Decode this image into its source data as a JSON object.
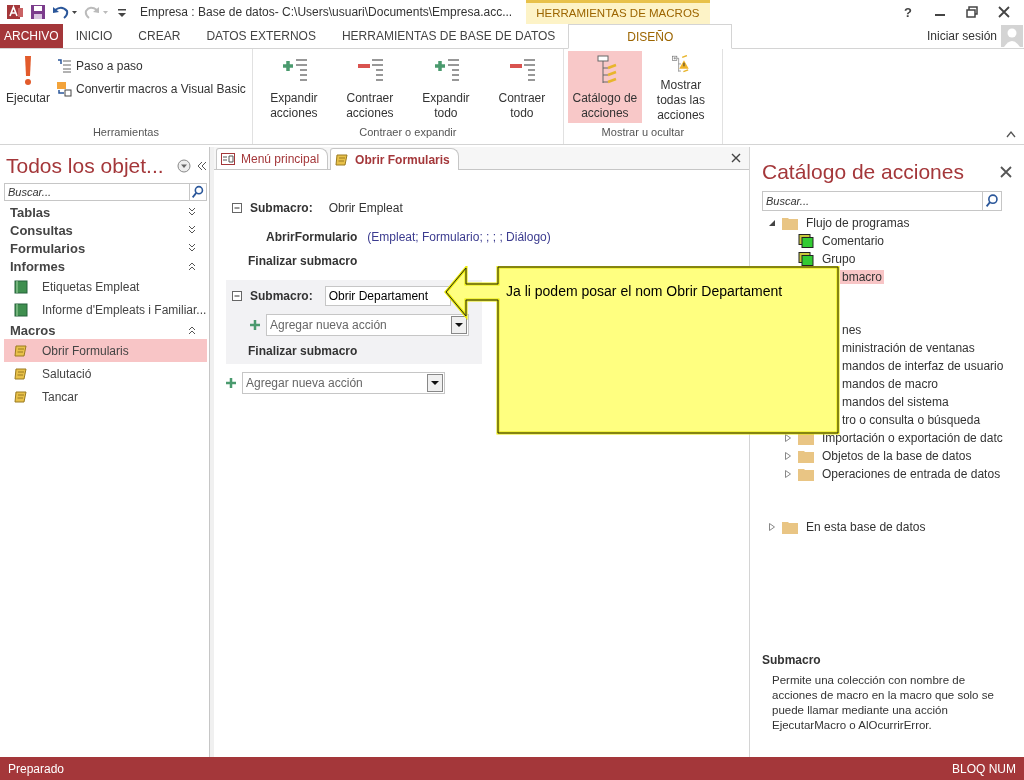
{
  "title_bar": {
    "title": "Empresa : Base de datos- C:\\Users\\usuari\\Documents\\Empresa.acc...",
    "context_tab": "HERRAMIENTAS DE MACROS",
    "help": "?"
  },
  "ribbon_tabs": [
    {
      "label": "ARCHIVO",
      "kind": "file",
      "selected": false
    },
    {
      "label": "INICIO",
      "kind": "normal",
      "selected": false
    },
    {
      "label": "CREAR",
      "kind": "normal",
      "selected": false
    },
    {
      "label": "DATOS EXTERNOS",
      "kind": "normal",
      "selected": false
    },
    {
      "label": "HERRAMIENTAS DE BASE DE DATOS",
      "kind": "normal",
      "selected": false
    },
    {
      "label": "DISEÑO",
      "kind": "context",
      "selected": true
    }
  ],
  "account": "Iniciar sesión",
  "ribbon_groups": [
    {
      "label": "Herramientas",
      "buttons": [
        {
          "label": "Ejecutar",
          "kind": "run",
          "selected": false
        },
        {
          "label": "Paso a paso",
          "kind": "step",
          "selected": false
        },
        {
          "label": "Convertir macros a Visual Basic",
          "kind": "convert",
          "selected": false
        }
      ]
    },
    {
      "label": "Contraer o expandir",
      "buttons": [
        {
          "label": "Expandir acciones",
          "kind": "expand",
          "selected": false
        },
        {
          "label": "Contraer acciones",
          "kind": "collapse",
          "selected": false
        },
        {
          "label": "Expandir todo",
          "kind": "expand",
          "selected": false
        },
        {
          "label": "Contraer todo",
          "kind": "collapse",
          "selected": false
        }
      ]
    },
    {
      "label": "Mostrar u ocultar",
      "buttons": [
        {
          "label": "Catálogo de acciones",
          "kind": "catalog",
          "selected": true
        },
        {
          "label": "Mostrar todas las acciones",
          "kind": "showall",
          "selected": false
        }
      ]
    }
  ],
  "nav": {
    "title": "Todos los objet...",
    "search_placeholder": "Buscar...",
    "groups": [
      {
        "label": "Tablas",
        "expanded": false
      },
      {
        "label": "Consultas",
        "expanded": false
      },
      {
        "label": "Formularios",
        "expanded": false
      },
      {
        "label": "Informes",
        "expanded": true,
        "items": [
          {
            "label": "Etiquetas Empleat",
            "kind": "report",
            "selected": false
          },
          {
            "label": "Informe d'Empleats i Familiar...",
            "kind": "report",
            "selected": false
          }
        ]
      },
      {
        "label": "Macros",
        "expanded": true,
        "items": [
          {
            "label": "Obrir Formularis",
            "kind": "macro",
            "selected": true
          },
          {
            "label": "Salutació",
            "kind": "macro",
            "selected": false
          },
          {
            "label": "Tancar",
            "kind": "macro",
            "selected": false
          }
        ]
      }
    ]
  },
  "doc_tabs": [
    {
      "label": "Menú principal",
      "kind": "form",
      "selected": false
    },
    {
      "label": "Obrir Formularis",
      "kind": "macro",
      "selected": true
    }
  ],
  "macro": {
    "submacros": [
      {
        "label": "Submacro:",
        "name": "Obrir Empleat",
        "selected": false,
        "actions": [
          {
            "name": "AbrirFormulario",
            "args": "(Empleat; Formulario; ; ; ; Diálogo)"
          }
        ],
        "end": "Finalizar submacro"
      },
      {
        "label": "Submacro:",
        "name": "Obrir Departament",
        "selected": true,
        "add_action": "Agregar nueva acción",
        "end": "Finalizar submacro"
      }
    ],
    "add_action": "Agregar nueva acción"
  },
  "callout": {
    "text": "Ja li podem posar el nom Obrir Departament"
  },
  "catalog": {
    "title": "Catálogo de acciones",
    "search_placeholder": "Buscar...",
    "tree": [
      {
        "label": "Flujo de programas",
        "kind": "folder",
        "expanded": true,
        "selected": false,
        "children": [
          {
            "label": "Comentario",
            "kind": "action",
            "selected": false
          },
          {
            "label": "Grupo",
            "kind": "action",
            "selected": false
          },
          {
            "label": "bmacro",
            "covered": true,
            "selected": true
          }
        ]
      },
      {
        "label": "nes",
        "expanded": true,
        "covered": true,
        "selected": false,
        "children": [
          {
            "label": "ministración de ventanas",
            "covered": true,
            "selected": false
          },
          {
            "label": "mandos de interfaz de usuario",
            "covered": true,
            "selected": false
          },
          {
            "label": "mandos de macro",
            "covered": true,
            "selected": false
          },
          {
            "label": "mandos del sistema",
            "covered": true,
            "selected": false
          },
          {
            "label": "tro o consulta o búsqueda",
            "covered": true,
            "selected": false
          },
          {
            "label": "Importación o exportación de datc",
            "kind": "folder",
            "expanded": false,
            "selected": false
          },
          {
            "label": "Objetos de la base de datos",
            "kind": "folder",
            "expanded": false,
            "selected": false
          },
          {
            "label": "Operaciones de entrada de datos",
            "kind": "folder",
            "expanded": false,
            "selected": false
          }
        ]
      },
      {
        "label": "En esta base de datos",
        "kind": "folder",
        "expanded": false,
        "selected": false
      }
    ],
    "description": {
      "title": "Submacro",
      "text": "Permite una colección con nombre de acciones de macro en la macro que solo se puede llamar mediante una acción EjecutarMacro o AlOcurrirError."
    }
  },
  "status_bar": {
    "left": "Preparado",
    "right": "BLOQ NUM"
  }
}
